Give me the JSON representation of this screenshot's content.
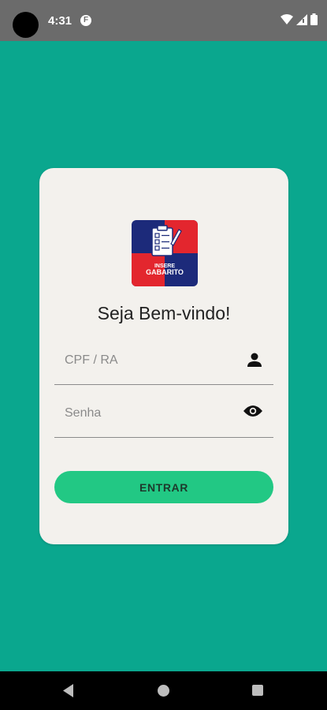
{
  "status_bar": {
    "time": "4:31",
    "notification_icon": "F",
    "icons": [
      "wifi-icon",
      "signal-icon",
      "battery-icon"
    ]
  },
  "login": {
    "logo_icon": "insere-gabarito-logo",
    "logo_text_top": "INSERE",
    "logo_text_bottom": "GABARITO",
    "welcome": "Seja Bem-vindo!",
    "cpf_placeholder": "CPF / RA",
    "cpf_value": "",
    "senha_placeholder": "Senha",
    "senha_value": "",
    "submit_label": "ENTRAR"
  },
  "colors": {
    "background": "#0aa78e",
    "card": "#f3f1ed",
    "button": "#22c884",
    "logo_blue": "#1c2a7a",
    "logo_red": "#e3262e"
  },
  "nav": {
    "icons": [
      "back-icon",
      "home-icon",
      "recents-icon"
    ]
  }
}
